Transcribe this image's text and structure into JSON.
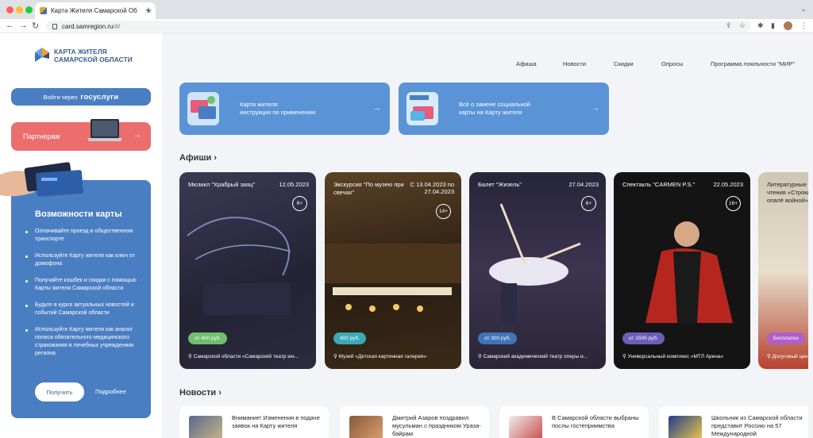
{
  "browser": {
    "tab_title": "Карта Жителя Самарской Об",
    "tab_close": "×",
    "new_tab": "+",
    "url_host": "card.samregion.ru",
    "url_path": "/#/",
    "back": "←",
    "forward": "→",
    "reload": "↻"
  },
  "sidebar": {
    "logo_line1": "КАРТА ЖИТЕЛЯ",
    "logo_line2": "САМАРСКОЙ ОБЛАСТИ",
    "gosuslugi_prefix": "Войти через",
    "gosuslugi_brand": "госуслуги",
    "partners_label": "Партнерам",
    "partners_arrow": "→",
    "features_title": "Возможности карты",
    "features": [
      "Оплачивайте проезд в общественном транспорте",
      "Используйте Карту жителя как ключ от домофона",
      "Получайте кэшбек и скидки с помощью Карты жителя Самарской области",
      "Будьте в курсе актуальных новостей и событий Самарской области",
      "Используйте Карту жителя как аналог полиса обязательного медицинского страхования в лечебных учреждениях региона"
    ],
    "get_button": "Получить",
    "more_link": "Подробнее"
  },
  "topnav": [
    "Афиша",
    "Новости",
    "Скидки",
    "Опросы",
    "Программа лояльности \"МИР\""
  ],
  "banners": [
    {
      "text1": "Карта жителя:",
      "text2": "инструкция по применению",
      "arrow": "→"
    },
    {
      "text1": "Всё о замене социальной",
      "text2": "карты на Карту жителя",
      "arrow": "→"
    }
  ],
  "afisha_title": "Афиши",
  "section_arrow": "›",
  "afisha": [
    {
      "name": "Мюзикл \"Храбрый заяц\"",
      "date": "12.05.2023",
      "age": "6+",
      "price": "от 400 руб.",
      "venue": "Самарской области «Самарский театр юн..."
    },
    {
      "name": "Экскурсия \"По музею при свечах\"",
      "date": "С 13.04.2023 по 27.04.2023",
      "age": "14+",
      "price": "400 руб.",
      "venue": "Музей «Детская картинная галерея»"
    },
    {
      "name": "Балет \"Жизель\"",
      "date": "27.04.2023",
      "age": "6+",
      "price": "от 300 руб.",
      "venue": "Самарский академический театр оперы и..."
    },
    {
      "name": "Спектакль \"CARMEN P.S.\"",
      "date": "22.05.2023",
      "age": "16+",
      "price": "от 1500 руб.",
      "venue": "Универсальный комплекс «МТЛ Арена»"
    },
    {
      "name": "Литературные чтения «Строки, опалё войной»",
      "date": "",
      "age": "",
      "price": "Бесплатно",
      "venue": "Досуговый цен..."
    }
  ],
  "news_title": "Новости",
  "news": [
    {
      "text": "Внимание! Изменения в подаче заявок на Карту жителя"
    },
    {
      "text": "Дмитрий Азаров поздравил мусульман с праздником Ураза-байрам"
    },
    {
      "text": "В Самарской области выбраны послы гостеприимства"
    },
    {
      "text": "Школьник из Самарской области представит Россию на 57 Международной"
    }
  ],
  "colors": {
    "primary": "#4a7ec2",
    "partners": "#ec6d6d",
    "banner": "#5a94d6"
  }
}
